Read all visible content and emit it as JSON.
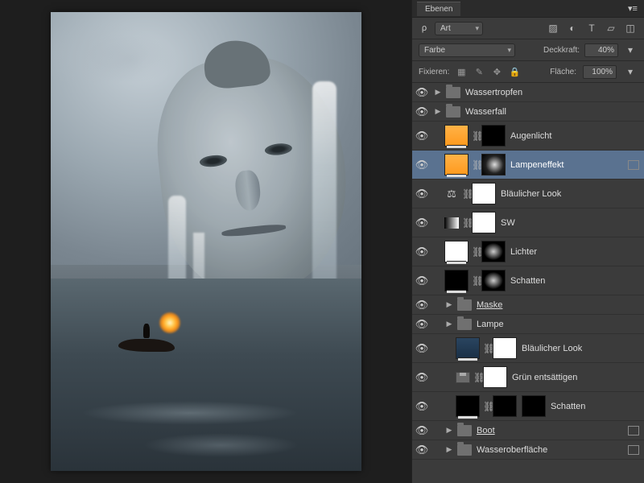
{
  "panel": {
    "tab": "Ebenen",
    "filter_mode": "Art",
    "blend_mode": "Farbe",
    "opacity_label": "Deckkraft:",
    "opacity_value": "40%",
    "lock_label": "Fixieren:",
    "fill_label": "Fläche:",
    "fill_value": "100%"
  },
  "filter_prefix": "ρ",
  "layers": [
    {
      "type": "group",
      "name": "Wassertropfen",
      "indent": 0
    },
    {
      "type": "group",
      "name": "Wasserfall",
      "indent": 0
    },
    {
      "type": "adj",
      "name": "Augenlicht",
      "indent": 1,
      "thumb": "orange",
      "mask": "blk"
    },
    {
      "type": "adj",
      "name": "Lampeneffekt",
      "indent": 1,
      "thumb": "orange",
      "mask": "mix",
      "selected": true,
      "fx": true
    },
    {
      "type": "adj",
      "name": "Bläulicher Look",
      "indent": 1,
      "thumb": "balance",
      "mask": "white"
    },
    {
      "type": "adj",
      "name": "SW",
      "indent": 1,
      "thumb": "gradient",
      "mask": "white"
    },
    {
      "type": "adj",
      "name": "Lichter",
      "indent": 1,
      "thumb": "white",
      "mask": "mix2"
    },
    {
      "type": "adj",
      "name": "Schatten",
      "indent": 1,
      "thumb": "black",
      "mask": "mix2"
    },
    {
      "type": "group",
      "name": "Maske",
      "indent": 1,
      "underline": true
    },
    {
      "type": "group",
      "name": "Lampe",
      "indent": 1
    },
    {
      "type": "adj",
      "name": "Bläulicher Look",
      "indent": 2,
      "thumb": "navy",
      "mask": "white"
    },
    {
      "type": "adj",
      "name": "Grün entsättigen",
      "indent": 2,
      "thumb": "floppy",
      "mask": "white"
    },
    {
      "type": "adj",
      "name": "Schatten",
      "indent": 2,
      "thumb": "black",
      "mask": "blk",
      "extra_mask": true
    },
    {
      "type": "group",
      "name": "Boot",
      "indent": 1,
      "underline": true,
      "fx": true
    },
    {
      "type": "group",
      "name": "Wasseroberfläche",
      "indent": 1,
      "fx": true
    }
  ]
}
